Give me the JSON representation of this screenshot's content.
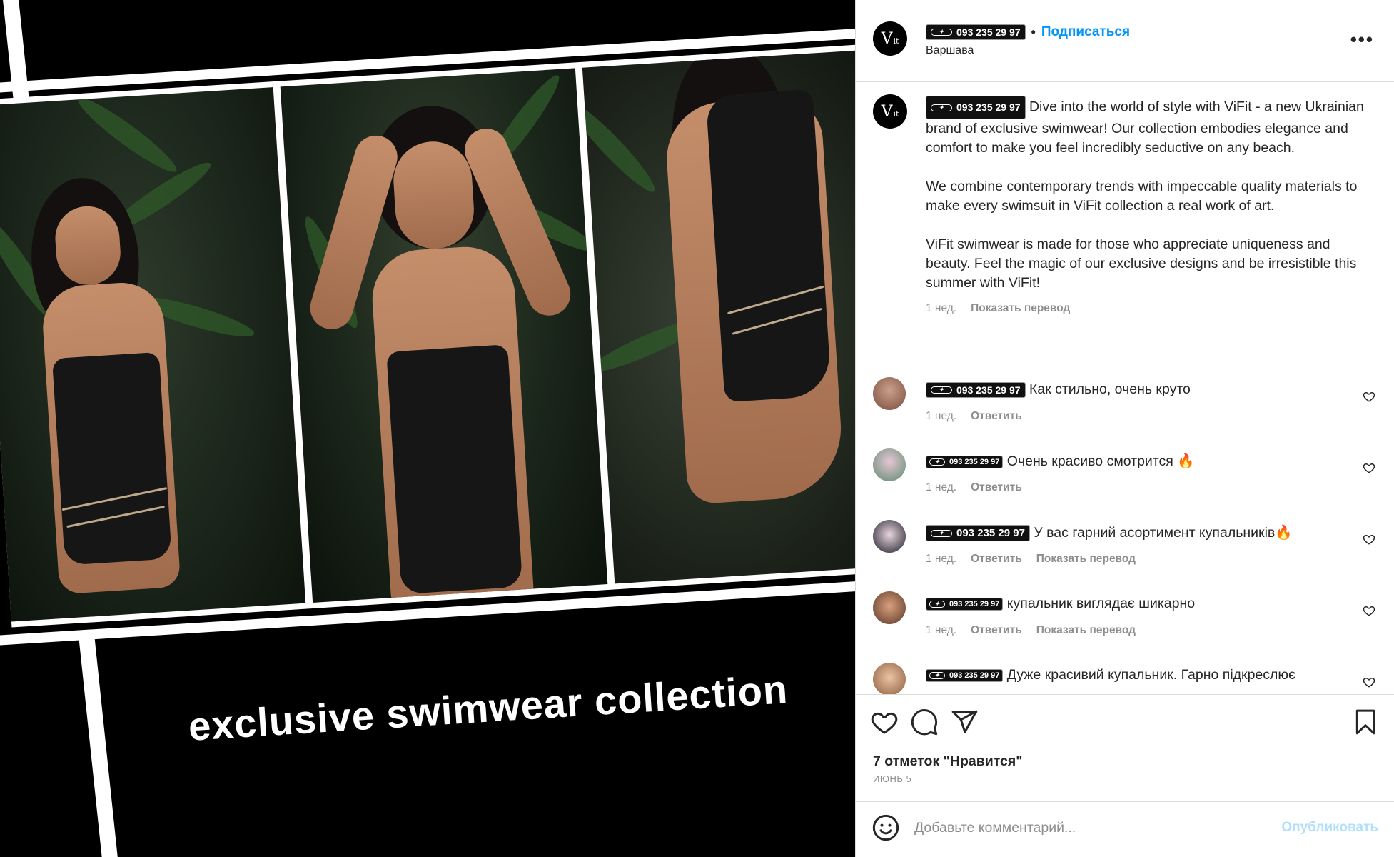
{
  "post": {
    "username_tag": "093 235 29 97",
    "follow_label": "Подписаться",
    "separator": "•",
    "location": "Варшава",
    "avatar_text": "V",
    "avatar_sub": "it",
    "headline": "exclusive swimwear collection",
    "caption": {
      "p1": "Dive into the world of style with ViFit - a new Ukrainian brand of exclusive swimwear! Our collection embodies elegance and comfort to make you feel incredibly seductive on any beach.",
      "p2": "We combine contemporary trends with impeccable quality materials to make every swimsuit in ViFit collection a real work of art.",
      "p3": "ViFit swimwear is made for those who appreciate uniqueness and beauty. Feel the magic of our exclusive designs and be irresistible this summer with ViFit!",
      "time": "1 нед.",
      "translate": "Показать перевод"
    },
    "comments": [
      {
        "tag": "093 235 29 97",
        "text": "Как стильно, очень круто",
        "time": "1 нед.",
        "reply": "Ответить",
        "translate": ""
      },
      {
        "tag": "093 235 29 97",
        "text": "Очень красиво смотрится 🔥",
        "time": "1 нед.",
        "reply": "Ответить",
        "translate": ""
      },
      {
        "tag": "093 235 29 97",
        "text": "У вас гарний асортимент купальників🔥",
        "time": "1 нед.",
        "reply": "Ответить",
        "translate": "Показать перевод"
      },
      {
        "tag": "093 235 29 97",
        "text": "купальник виглядає шикарно",
        "time": "1 нед.",
        "reply": "Ответить",
        "translate": "Показать перевод"
      },
      {
        "tag": "093 235 29 97",
        "text": "Дуже красивий купальник. Гарно підкреслює",
        "time": "",
        "reply": "",
        "translate": ""
      }
    ],
    "likes": "7 отметок \"Нравится\"",
    "date": "ИЮНЬ 5",
    "comment_placeholder": "Добавьте комментарий...",
    "publish_label": "Опубликовать"
  },
  "icons": {
    "like": "heart-icon",
    "comment": "comment-icon",
    "share": "send-icon",
    "save": "bookmark-icon",
    "emoji": "smiley-icon",
    "more": "more-icon"
  },
  "colors": {
    "link": "#0095f6",
    "muted": "#8e8e8e",
    "publish_disabled": "#b2dffc"
  }
}
